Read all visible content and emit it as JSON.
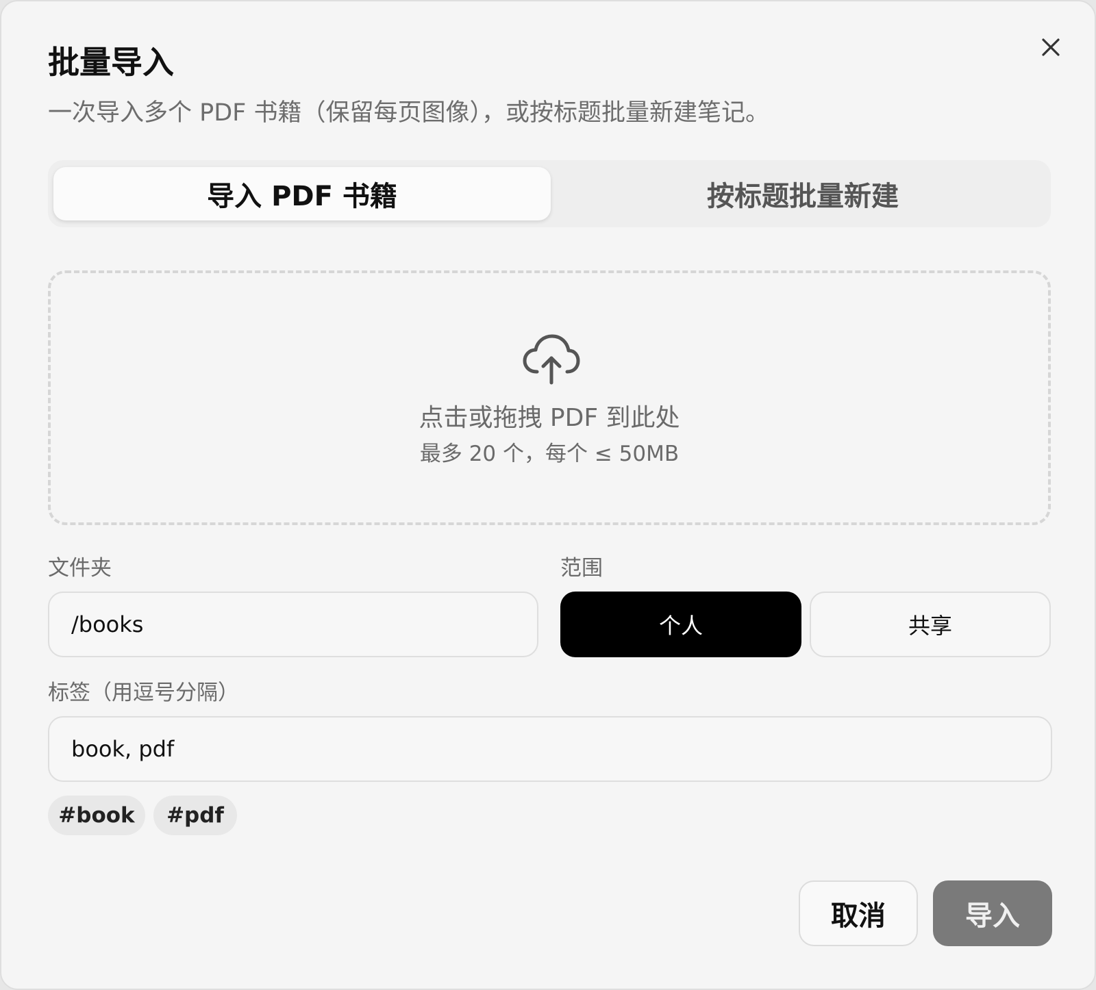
{
  "dialog": {
    "title": "批量导入",
    "subtitle": "一次导入多个 PDF 书籍（保留每页图像），或按标题批量新建笔记。",
    "close_icon": "close-icon"
  },
  "tabs": [
    {
      "label": "导入 PDF 书籍",
      "active": true
    },
    {
      "label": "按标题批量新建",
      "active": false
    }
  ],
  "dropzone": {
    "icon": "cloud-upload-icon",
    "main_text": "点击或拖拽 PDF 到此处",
    "sub_text": "最多 20 个，每个 ≤ 50MB"
  },
  "folder": {
    "label": "文件夹",
    "value": "/books"
  },
  "scope": {
    "label": "范围",
    "options": [
      {
        "label": "个人",
        "selected": true
      },
      {
        "label": "共享",
        "selected": false
      }
    ]
  },
  "tags": {
    "label": "标签（用逗号分隔）",
    "value": "book, pdf",
    "chips": [
      "#book",
      "#pdf"
    ]
  },
  "actions": {
    "cancel_label": "取消",
    "import_label": "导入"
  },
  "colors": {
    "background": "#f5f5f5",
    "selected_segment": "#000000",
    "primary_button_disabled": "#7a7a7a",
    "muted_text": "#6a6a6a"
  }
}
